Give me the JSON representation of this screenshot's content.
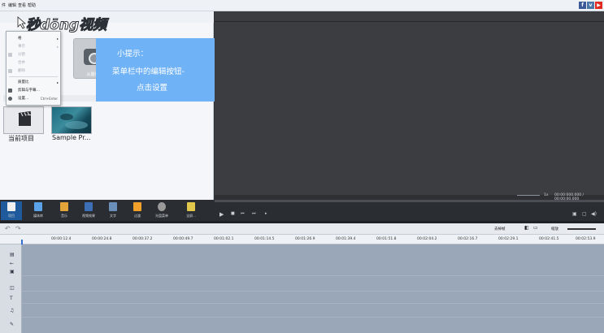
{
  "menubar": {
    "items": [
      "件",
      "编辑",
      "查看",
      "帮助"
    ],
    "social": [
      {
        "name": "facebook-icon",
        "glyph": "f",
        "color": "#3b5998"
      },
      {
        "name": "vk-icon",
        "glyph": "v",
        "color": "#4a76a8"
      },
      {
        "name": "youtube-icon",
        "glyph": "▶",
        "color": "#e02a20"
      }
    ]
  },
  "library": {
    "tile_caption": "从摄像",
    "items": [
      {
        "label": "当前项目"
      },
      {
        "label": "Sample Pr..."
      }
    ]
  },
  "context_menu": {
    "items": [
      {
        "label": "格",
        "arrow": true,
        "disabled": false,
        "icon": ""
      },
      {
        "label": "事示",
        "arrow": true,
        "disabled": true,
        "icon": ""
      },
      {
        "label": "分割",
        "arrow": false,
        "disabled": true,
        "icon": "#c6cbd1"
      },
      {
        "label": "合并",
        "arrow": false,
        "disabled": true,
        "icon": ""
      },
      {
        "label": "删除",
        "arrow": false,
        "disabled": true,
        "icon": "#c6cbd1"
      },
      {
        "label": "质量比",
        "arrow": true,
        "disabled": false,
        "icon": ""
      },
      {
        "label": "剪辑与字幕…",
        "arrow": false,
        "disabled": false,
        "icon": "#5a5f66"
      },
      {
        "label": "设置…",
        "arrow": false,
        "disabled": false,
        "icon": "#5a5f66",
        "shortcut": "Ctrl+Enter"
      }
    ]
  },
  "watermark": {
    "text": "秒dōng视频"
  },
  "tooltip": {
    "lines": [
      "小提示：",
      "菜单栏中的编辑按钮-",
      "点击设置"
    ]
  },
  "toolbar": {
    "items": [
      {
        "label": "项目",
        "icon": "#f0f0f0",
        "active": true
      },
      {
        "label": "媒体库",
        "icon": "#5aa3e8",
        "active": false
      },
      {
        "label": "音乐",
        "icon": "#e3a53a",
        "active": false
      },
      {
        "label": "视频效果",
        "icon": "#3c6fb5",
        "active": false
      },
      {
        "label": "文字",
        "icon": "#6a8fb8",
        "active": false
      },
      {
        "label": "过渡",
        "icon": "#f2a12b",
        "active": false
      },
      {
        "label": "光盘菜单",
        "icon": "#9a9a9a",
        "active": false
      },
      {
        "label": "全屏...",
        "icon": "#e2c84a",
        "active": false
      }
    ]
  },
  "preview": {
    "speed_label": "1x",
    "time": "00:00:000.000 / 00:00:00.000",
    "controls": [
      "▶",
      "■",
      "⏮",
      "⏭",
      "▸"
    ]
  },
  "timeline": {
    "toolbar_right": [
      "去掉帧",
      "编辑",
      "缩放"
    ],
    "ticks": [
      "00:00:12.4",
      "00:00:24.8",
      "00:00:37.2",
      "00:00:49.7",
      "00:01:02.1",
      "00:01:14.5",
      "00:01:26.9",
      "00:01:39.4",
      "00:01:51.8",
      "00:02:04.2",
      "00:02:16.7",
      "00:02:29.1",
      "00:02:41.5",
      "00:02:53.9"
    ],
    "track_icons": [
      "film-icon",
      "audio-icon",
      "video-icon",
      "text-icon",
      "music-icon",
      "mic-icon"
    ]
  }
}
